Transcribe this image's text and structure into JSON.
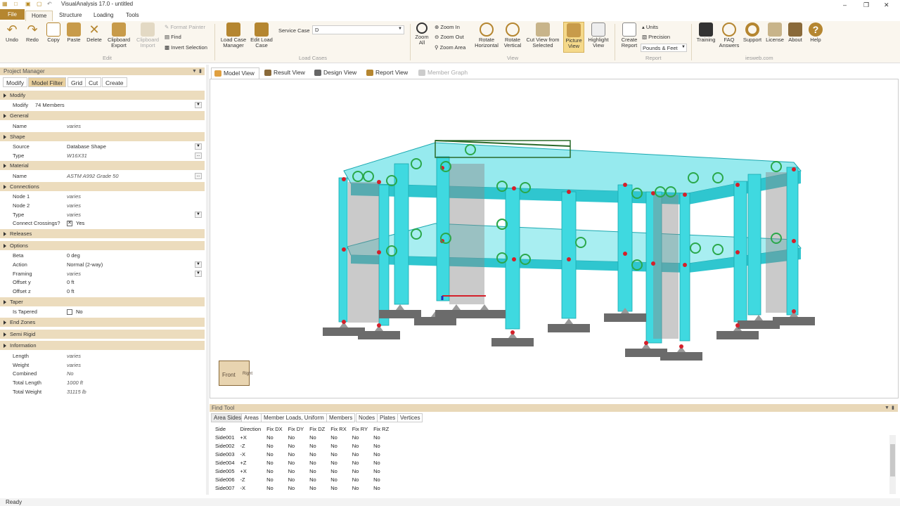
{
  "window": {
    "title": "VisualAnalysis 17.0 - untitled",
    "minimize": "–",
    "maximize": "❐",
    "close": "✕"
  },
  "ribbon_tabs": {
    "file": "File",
    "items": [
      "Home",
      "Structure",
      "Loading",
      "Tools"
    ]
  },
  "ribbon": {
    "edit": {
      "undo": "Undo",
      "redo": "Redo",
      "copy": "Copy",
      "paste": "Paste",
      "delete": "Delete",
      "clipboard_export": "Clipboard Export",
      "clipboard_import": "Clipboard Import",
      "format_painter": "Format Painter",
      "find": "Find",
      "invert_selection": "Invert Selection",
      "group": "Edit"
    },
    "load_cases": {
      "manager": "Load Case Manager",
      "edit": "Edit Load Case",
      "service_case_label": "Service Case",
      "service_case_value": "D",
      "group": "Load Cases"
    },
    "view": {
      "zoom_all": "Zoom All",
      "zoom_in": "Zoom In",
      "zoom_out": "Zoom Out",
      "zoom_area": "Zoom Area",
      "rotate_horizontal": "Rotate Horizontal",
      "rotate_vertical": "Rotate Vertical",
      "cut_view": "Cut View from Selected",
      "picture_view": "Picture View",
      "highlight_view": "Highlight View",
      "group": "View"
    },
    "report": {
      "create_report": "Create Report",
      "units": "Units",
      "precision": "Precision",
      "unit_system": "Pounds & Feet",
      "group": "Report"
    },
    "iesweb": {
      "training": "Training",
      "faq": "FAQ Answers",
      "support": "Support",
      "license": "License",
      "about": "About",
      "help": "Help",
      "group": "iesweb.com"
    }
  },
  "project_manager": {
    "title": "Project Manager",
    "tabs": [
      "Modify",
      "Model Filter",
      "Grid",
      "Cut",
      "Create"
    ],
    "modify_section": "Modify",
    "modify_label": "Modify",
    "modify_value": "74 Members",
    "categories": {
      "general": "General",
      "shape": "Shape",
      "material": "Material",
      "connections": "Connections",
      "releases": "Releases",
      "options": "Options",
      "taper": "Taper",
      "end_zones": "End Zones",
      "semi_rigid": "Semi Rigid",
      "information": "Information"
    },
    "props": {
      "name_label": "Name",
      "name_value": "varies",
      "source_label": "Source",
      "source_value": "Database Shape",
      "type_label": "Type",
      "type_value": "W16X31",
      "mat_name_label": "Name",
      "mat_name_value": "ASTM A992 Grade 50",
      "node1_label": "Node 1",
      "node1_value": "varies",
      "node2_label": "Node 2",
      "node2_value": "varies",
      "conn_type_label": "Type",
      "conn_type_value": "varies",
      "crossings_label": "Connect Crossings?",
      "crossings_value": "Yes",
      "beta_label": "Beta",
      "beta_value": "0 deg",
      "action_label": "Action",
      "action_value": "Normal (2-way)",
      "framing_label": "Framing",
      "framing_value": "varies",
      "offy_label": "Offset y",
      "offy_value": "0 ft",
      "offz_label": "Offset z",
      "offz_value": "0 ft",
      "tapered_label": "Is Tapered",
      "tapered_value": "No",
      "length_label": "Length",
      "length_value": "varies",
      "weight_label": "Weight",
      "weight_value": "varies",
      "combined_label": "Combined",
      "combined_value": "No",
      "total_length_label": "Total Length",
      "total_length_value": "1000 ft",
      "total_weight_label": "Total Weight",
      "total_weight_value": "31115 lb"
    }
  },
  "view_tabs": [
    "Model View",
    "Result View",
    "Design View",
    "Report View",
    "Member Graph"
  ],
  "viewcube": {
    "front": "Front",
    "right": "Right"
  },
  "find_tool": {
    "title": "Find Tool",
    "tabs": [
      "Area Sides",
      "Areas",
      "Member Loads, Uniform",
      "Members",
      "Nodes",
      "Plates",
      "Vertices"
    ],
    "columns": [
      "Side",
      "Direction",
      "Fix DX",
      "Fix DY",
      "Fix DZ",
      "Fix RX",
      "Fix RY",
      "Fix RZ"
    ],
    "rows": [
      [
        "Side001",
        "+X",
        "No",
        "No",
        "No",
        "No",
        "No",
        "No"
      ],
      [
        "Side002",
        "-Z",
        "No",
        "No",
        "No",
        "No",
        "No",
        "No"
      ],
      [
        "Side003",
        "-X",
        "No",
        "No",
        "No",
        "No",
        "No",
        "No"
      ],
      [
        "Side004",
        "+Z",
        "No",
        "No",
        "No",
        "No",
        "No",
        "No"
      ],
      [
        "Side005",
        "+X",
        "No",
        "No",
        "No",
        "No",
        "No",
        "No"
      ],
      [
        "Side006",
        "-Z",
        "No",
        "No",
        "No",
        "No",
        "No",
        "No"
      ],
      [
        "Side007",
        "-X",
        "No",
        "No",
        "No",
        "No",
        "No",
        "No"
      ]
    ]
  },
  "status": {
    "text": "Ready"
  },
  "colors": {
    "accent": "#b58630",
    "panel_header": "#e9d8b8",
    "category_row": "#ecdcbd",
    "member_cyan": "#3fd9e0",
    "support_gray": "#6b6b6b",
    "node_red": "#d4202a",
    "release_green": "#2aa84a"
  }
}
